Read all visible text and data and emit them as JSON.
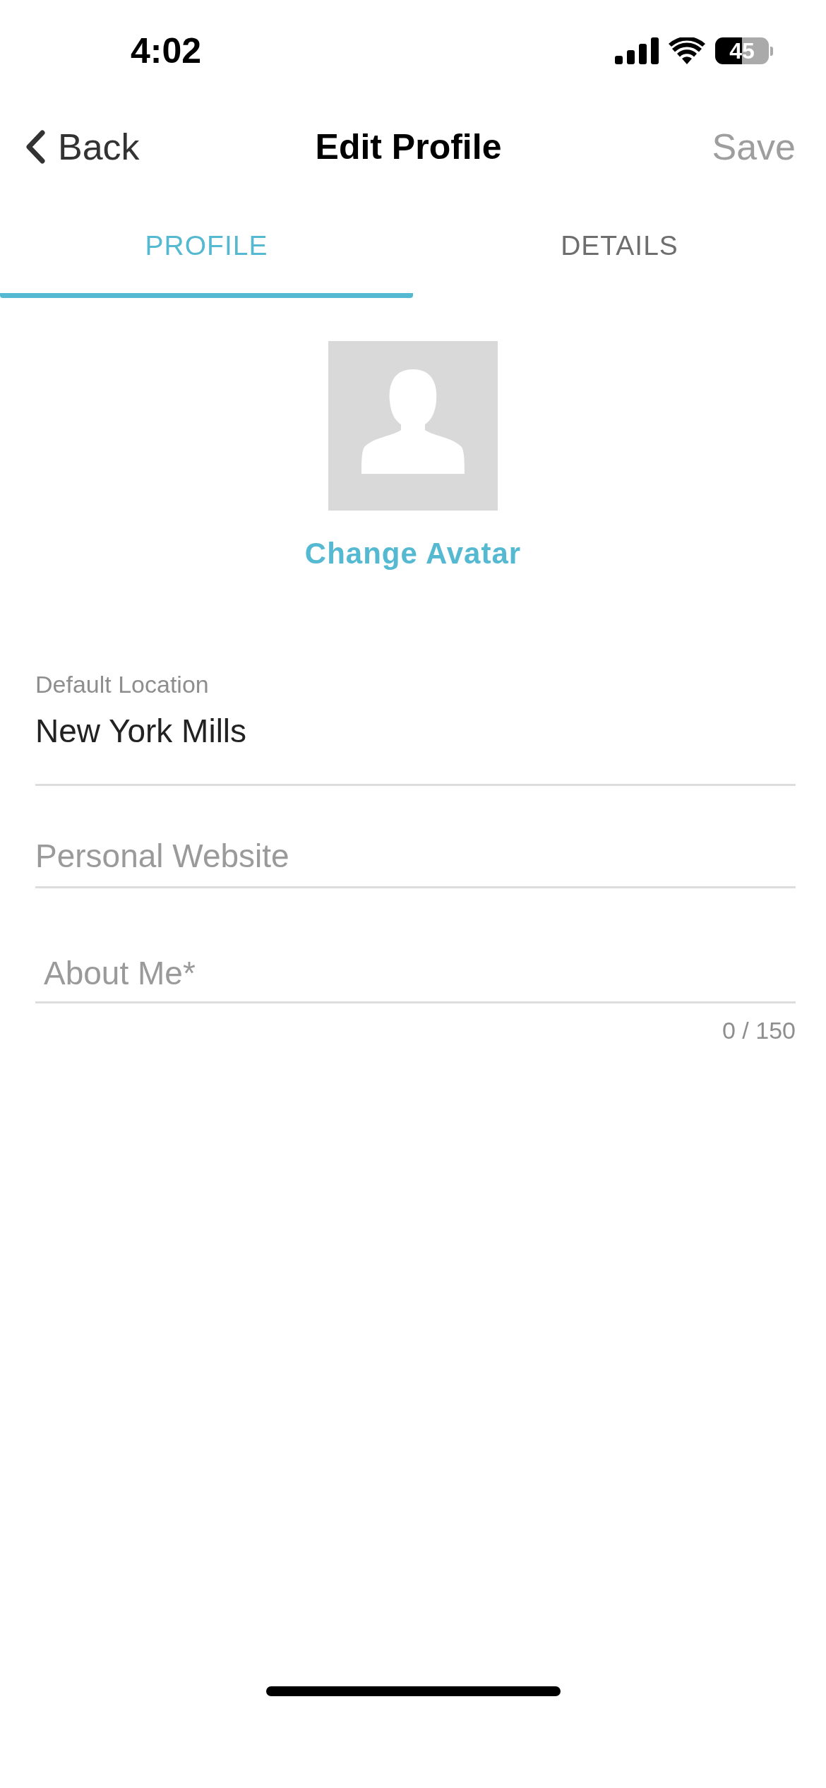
{
  "status_bar": {
    "time": "4:02",
    "battery": "45"
  },
  "nav": {
    "back": "Back",
    "title": "Edit Profile",
    "save": {
      "label": "Save",
      "disabled": true
    }
  },
  "tabs": [
    {
      "label": "PROFILE",
      "selected": true
    },
    {
      "label": "DETAILS",
      "selected": false
    }
  ],
  "avatar": {
    "action": "Change Avatar"
  },
  "fields": [
    {
      "label": "Default Location",
      "value": "New York Mills"
    },
    {
      "placeholder": "Personal Website"
    },
    {
      "placeholder": "About Me*",
      "counter": "0 / 150"
    }
  ]
}
